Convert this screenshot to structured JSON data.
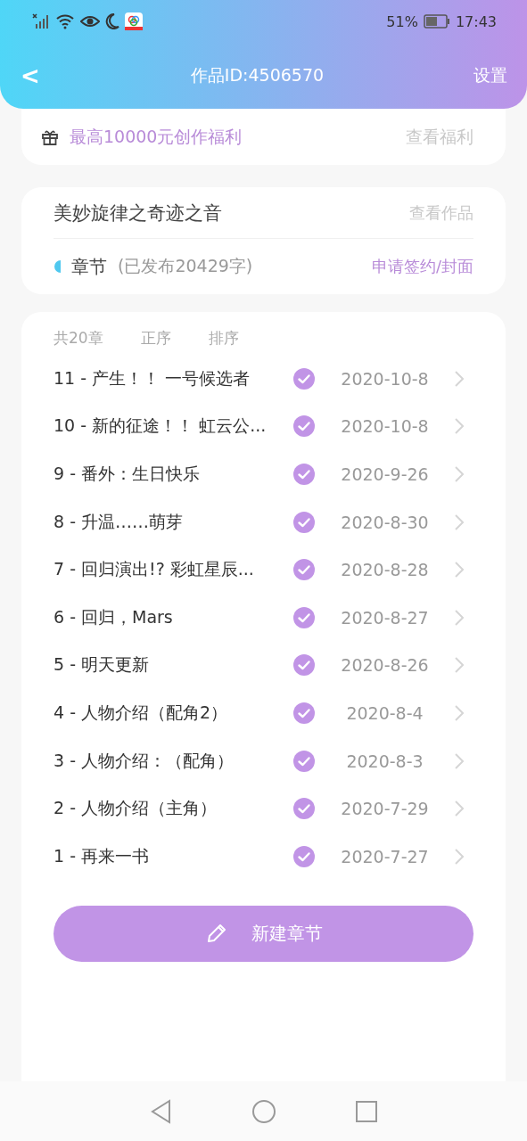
{
  "status_bar": {
    "battery": "51%",
    "time": "17:43"
  },
  "header": {
    "back": "<",
    "title": "作品ID:4506570",
    "settings": "设置"
  },
  "benefit": {
    "text": "最高10000元创作福利",
    "link": "查看福利"
  },
  "work": {
    "title": "美妙旋律之奇迹之音",
    "view": "查看作品",
    "section": "章节",
    "published_info": "(已发布20429字)",
    "apply": "申请签约/封面"
  },
  "chapters_toolbar": {
    "count": "共20章",
    "order": "正序",
    "sort": "排序"
  },
  "chapters": [
    {
      "title": "11 - 产生！！ 一号候选者",
      "published": true,
      "date": "2020-10-8"
    },
    {
      "title": "10 - 新的征途！！ 虹云公...",
      "published": true,
      "date": "2020-10-8"
    },
    {
      "title": "9 - 番外：生日快乐",
      "published": true,
      "date": "2020-9-26"
    },
    {
      "title": "8 - 升温……萌芽",
      "published": true,
      "date": "2020-8-30"
    },
    {
      "title": "7 - 回归演出!? 彩虹星辰...",
      "published": true,
      "date": "2020-8-28"
    },
    {
      "title": "6 - 回归，Mars",
      "published": true,
      "date": "2020-8-27"
    },
    {
      "title": "5 - 明天更新",
      "published": true,
      "date": "2020-8-26"
    },
    {
      "title": "4 - 人物介绍（配角2）",
      "published": true,
      "date": "2020-8-4"
    },
    {
      "title": "3 - 人物介绍：（配角）",
      "published": true,
      "date": "2020-8-3"
    },
    {
      "title": "2 - 人物介绍（主角）",
      "published": true,
      "date": "2020-7-29"
    },
    {
      "title": "1 - 再来一书",
      "published": true,
      "date": "2020-7-27"
    }
  ],
  "new_chapter_button": "新建章节"
}
